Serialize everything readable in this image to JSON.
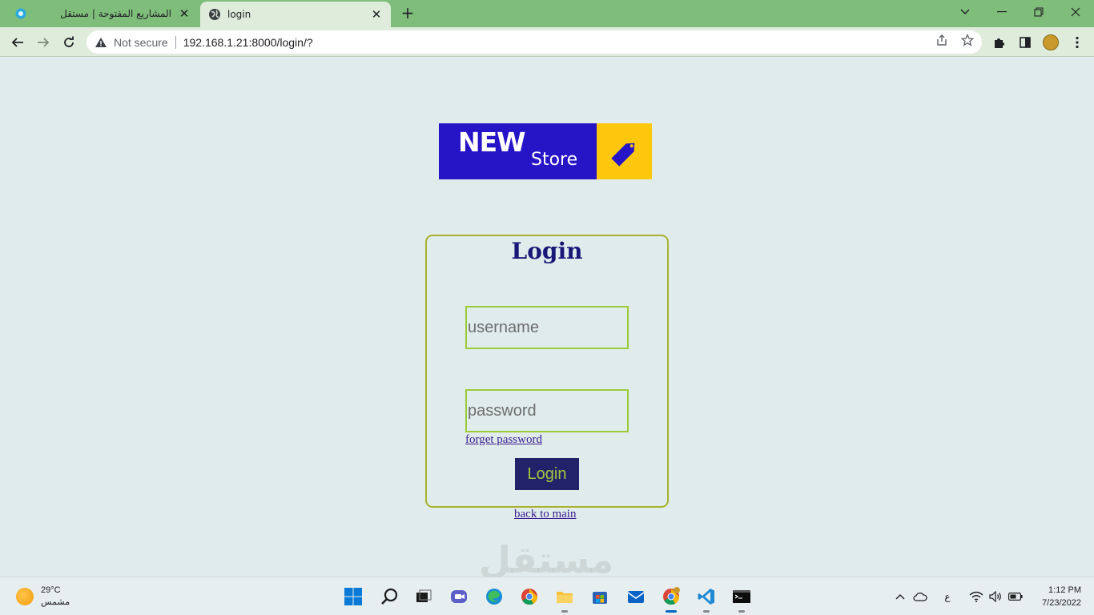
{
  "browser": {
    "tabs": [
      {
        "title": "المشاريع المفتوحة | مستقل",
        "active": false,
        "icon": "mostaql-favicon-icon"
      },
      {
        "title": "login",
        "active": true,
        "icon": "globe-icon"
      }
    ],
    "security_label": "Not secure",
    "url": "192.168.1.21:8000/login/?"
  },
  "logo": {
    "word1": "NEW",
    "word2": "Store",
    "left_color": "#2614c7",
    "right_color": "#fdc70c"
  },
  "login_form": {
    "title": "Login",
    "username_placeholder": "username",
    "password_placeholder": "password",
    "forget_link": "forget password",
    "submit_label": "Login",
    "back_link": "back to main"
  },
  "watermark": "مستقل",
  "taskbar": {
    "weather_temp": "29°C",
    "weather_desc": "مشمس",
    "language_indicator": "ع",
    "time": "1:12 PM",
    "date": "7/23/2022"
  }
}
